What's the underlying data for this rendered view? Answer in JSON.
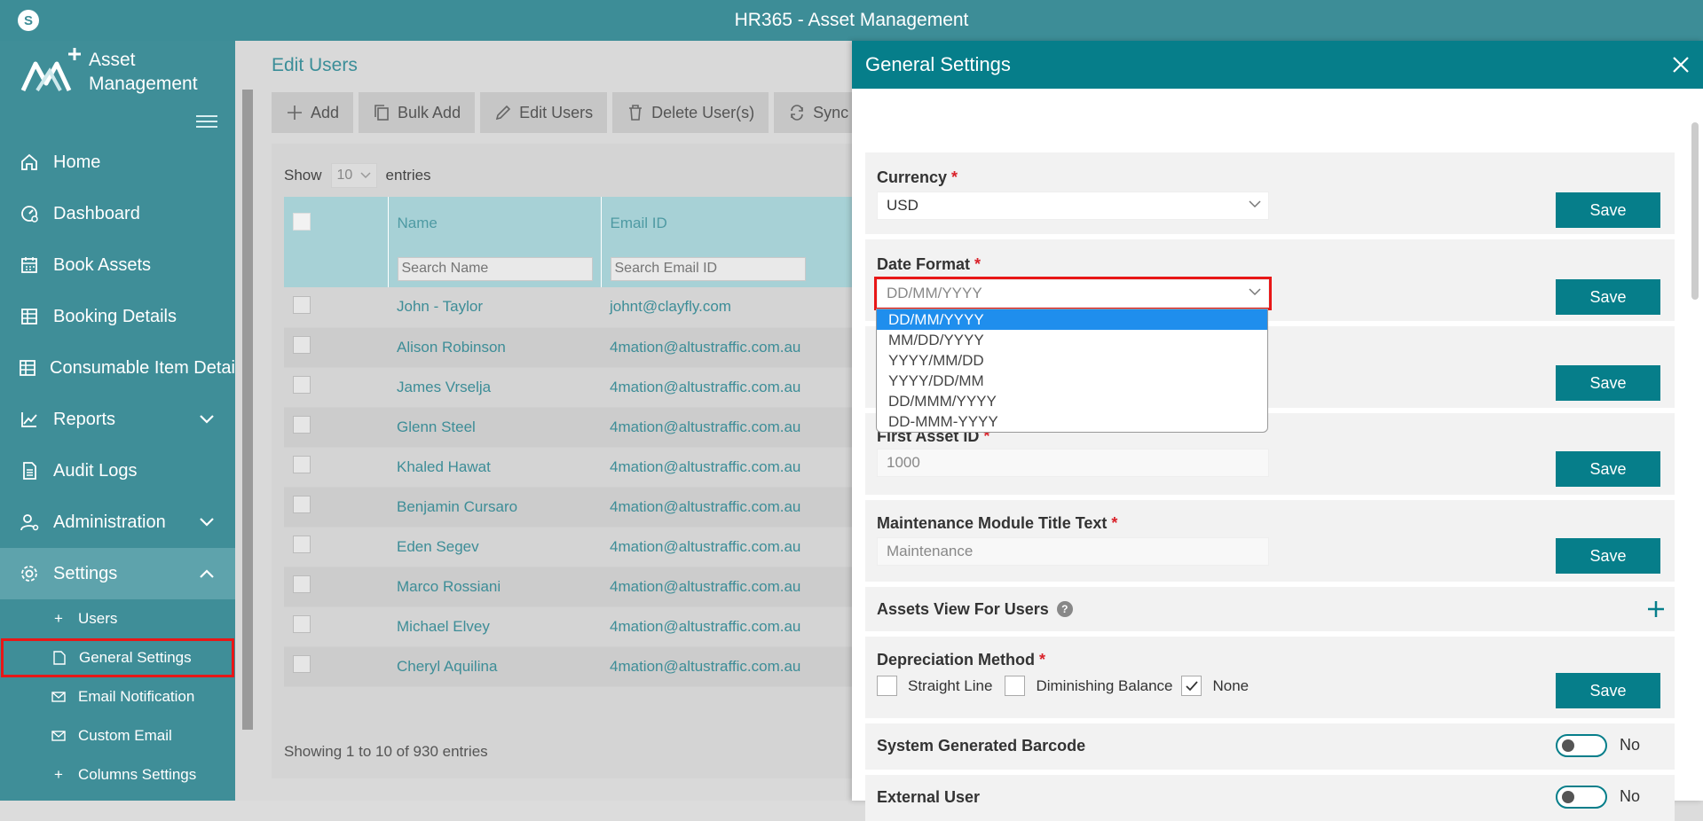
{
  "window": {
    "title": "HR365 - Asset Management"
  },
  "logo": {
    "line1": "Asset",
    "line2": "Management"
  },
  "nav": [
    {
      "label": "Home",
      "icon": "home-icon"
    },
    {
      "label": "Dashboard",
      "icon": "dashboard-icon"
    },
    {
      "label": "Book Assets",
      "icon": "calendar-icon"
    },
    {
      "label": "Booking Details",
      "icon": "table-icon"
    },
    {
      "label": "Consumable Item Details",
      "icon": "table-icon"
    },
    {
      "label": "Reports",
      "icon": "chart-icon"
    },
    {
      "label": "Audit Logs",
      "icon": "document-icon"
    },
    {
      "label": "Administration",
      "icon": "user-gear-icon"
    },
    {
      "label": "Settings",
      "icon": "gear-icon"
    }
  ],
  "settings_sub": [
    {
      "label": "Users",
      "icon": "plus-icon"
    },
    {
      "label": "General Settings",
      "icon": "page-icon"
    },
    {
      "label": "Email Notification",
      "icon": "mail-icon"
    },
    {
      "label": "Custom Email",
      "icon": "mail-icon"
    },
    {
      "label": "Columns Settings",
      "icon": "plus-icon"
    }
  ],
  "edit_users": {
    "title": "Edit Users",
    "toolbar": [
      "Add",
      "Bulk Add",
      "Edit Users",
      "Delete User(s)",
      "Sync"
    ],
    "show_label": "Show",
    "show_value": "10",
    "entries_label": "entries",
    "columns": [
      "Name",
      "Email ID"
    ],
    "search_name_placeholder": "Search Name",
    "search_email_placeholder": "Search Email ID",
    "rows": [
      {
        "name": "John - Taylor",
        "email": "johnt@clayfly.com"
      },
      {
        "name": "Alison Robinson",
        "email": "4mation@altustraffic.com.au"
      },
      {
        "name": "James Vrselja",
        "email": "4mation@altustraffic.com.au"
      },
      {
        "name": "Glenn Steel",
        "email": "4mation@altustraffic.com.au"
      },
      {
        "name": "Khaled Hawat",
        "email": "4mation@altustraffic.com.au"
      },
      {
        "name": "Benjamin Cursaro",
        "email": "4mation@altustraffic.com.au"
      },
      {
        "name": "Eden Segev",
        "email": "4mation@altustraffic.com.au"
      },
      {
        "name": "Marco Rossiani",
        "email": "4mation@altustraffic.com.au"
      },
      {
        "name": "Michael Elvey",
        "email": "4mation@altustraffic.com.au"
      },
      {
        "name": "Cheryl Aquilina",
        "email": "4mation@altustraffic.com.au"
      }
    ],
    "showing": "Showing 1 to 10 of 930 entries"
  },
  "general_settings": {
    "title": "General Settings",
    "save_label": "Save",
    "currency": {
      "label": "Currency",
      "value": "USD"
    },
    "date_format": {
      "label": "Date Format",
      "value": "DD/MM/YYYY",
      "options": [
        "DD/MM/YYYY",
        "MM/DD/YYYY",
        "YYYY/MM/DD",
        "YYYY/DD/MM",
        "DD/MMM/YYYY",
        "DD-MMM-YYYY"
      ]
    },
    "first_asset_id": {
      "label": "First Asset ID",
      "value": "1000"
    },
    "maintenance_title": {
      "label": "Maintenance Module Title Text",
      "value": "Maintenance"
    },
    "assets_view": {
      "label": "Assets View For Users"
    },
    "depreciation": {
      "label": "Depreciation Method",
      "options": [
        "Straight Line",
        "Diminishing Balance",
        "None"
      ],
      "checked": "None"
    },
    "system_barcode": {
      "label": "System Generated Barcode",
      "value": "No"
    },
    "external_user": {
      "label": "External User",
      "value": "No"
    }
  },
  "colors": {
    "accent": "#067e8a",
    "sidebar": "#3f8e98",
    "highlight": "#e81717",
    "selected_option": "#1f8eed"
  }
}
